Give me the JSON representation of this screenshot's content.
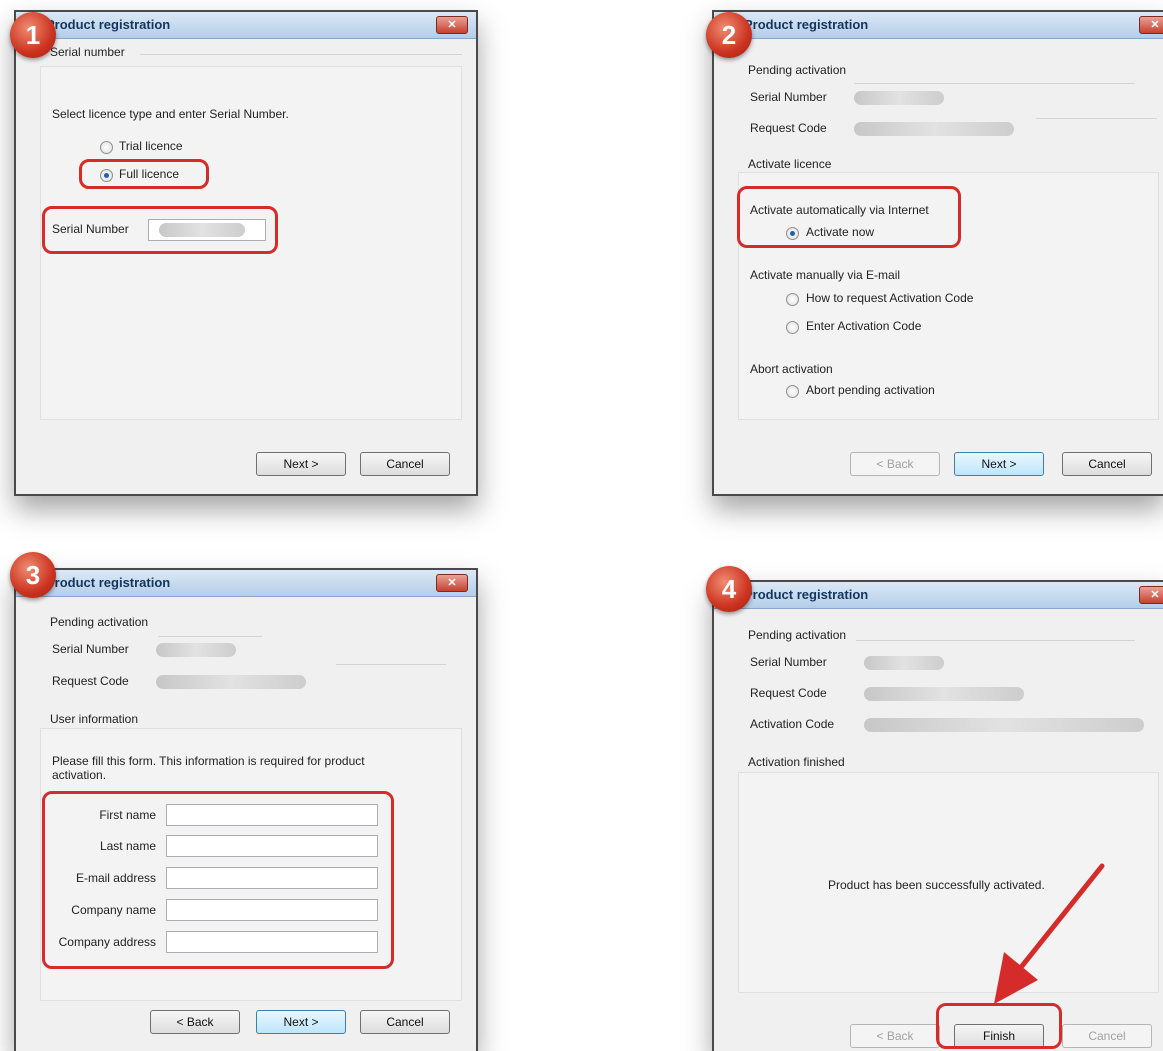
{
  "steps": [
    "1",
    "2",
    "3",
    "4"
  ],
  "window_title": "Product registration",
  "close_glyph": "✕",
  "panel1": {
    "section": "Serial number",
    "instruction": "Select licence type and enter Serial Number.",
    "trial_label": "Trial licence",
    "full_label": "Full licence",
    "serial_label": "Serial Number",
    "next": "Next >",
    "cancel": "Cancel"
  },
  "panel2": {
    "pending": "Pending activation",
    "serial_label": "Serial Number",
    "request_label": "Request Code",
    "activate_section": "Activate licence",
    "auto_label": "Activate automatically via Internet",
    "activate_now": "Activate now",
    "manual_label": "Activate manually via E-mail",
    "how_to": "How to request Activation Code",
    "enter_code": "Enter Activation Code",
    "abort_label": "Abort activation",
    "abort_pending": "Abort pending activation",
    "back": "< Back",
    "next": "Next >",
    "cancel": "Cancel"
  },
  "panel3": {
    "pending": "Pending activation",
    "serial_label": "Serial Number",
    "request_label": "Request Code",
    "user_section": "User information",
    "instruction_line1": "Please fill this form. This information is required for product",
    "instruction_line2": "activation.",
    "first_name": "First name",
    "last_name": "Last name",
    "email": "E-mail address",
    "company_name": "Company name",
    "company_address": "Company address",
    "back": "< Back",
    "next": "Next >",
    "cancel": "Cancel"
  },
  "panel4": {
    "pending": "Pending activation",
    "serial_label": "Serial Number",
    "request_label": "Request Code",
    "activation_label": "Activation Code",
    "finished_section": "Activation finished",
    "success_msg": "Product has been successfully activated.",
    "back": "< Back",
    "finish": "Finish",
    "cancel": "Cancel"
  },
  "colors": {
    "highlight": "#d62b2b",
    "badge": "#cc3320",
    "title_text": "#14365d"
  }
}
